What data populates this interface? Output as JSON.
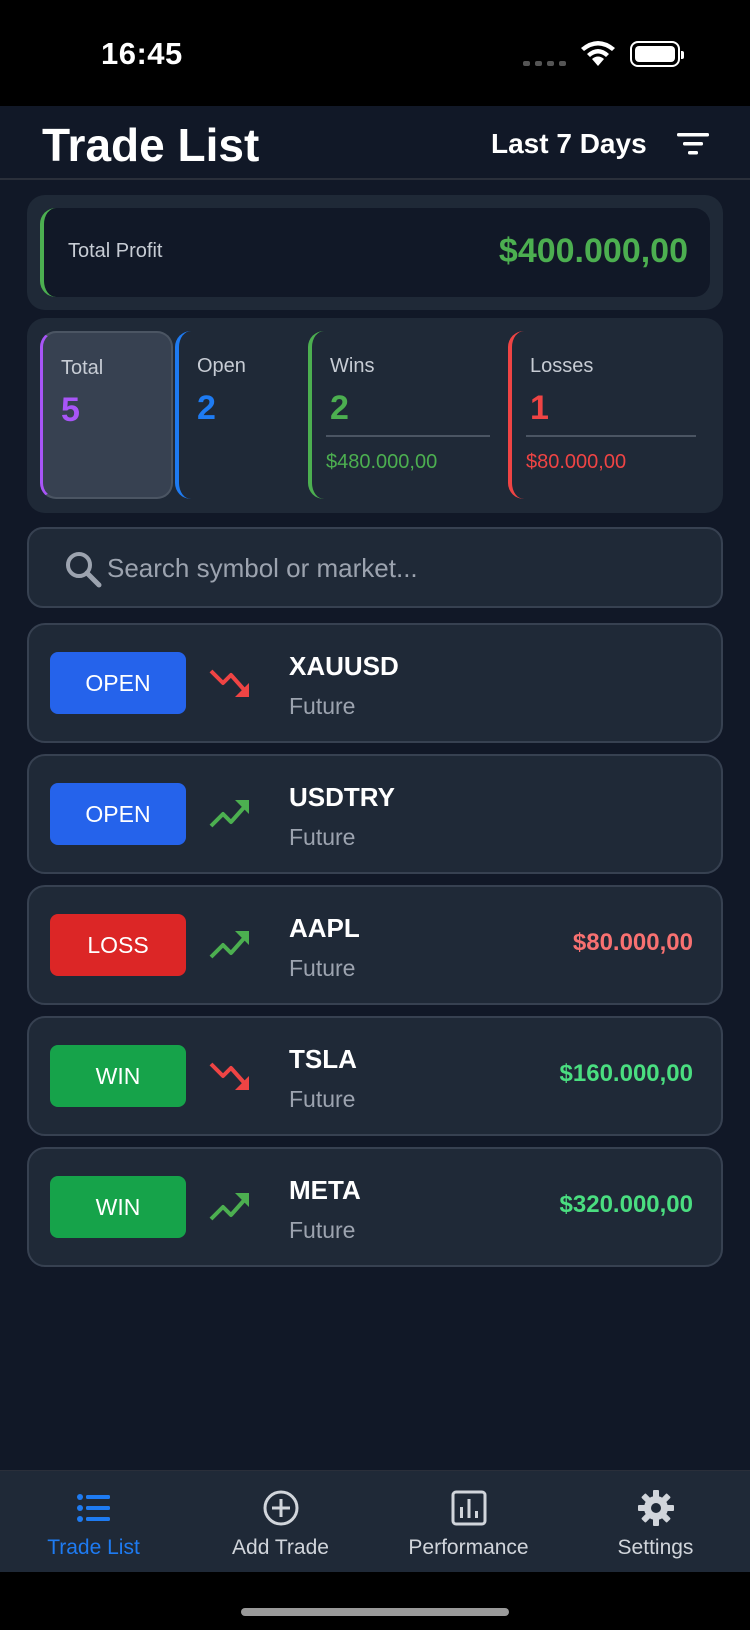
{
  "status_bar": {
    "time": "16:45"
  },
  "header": {
    "title": "Trade List",
    "range_label": "Last 7 Days"
  },
  "profit": {
    "label": "Total Profit",
    "value": "$400.000,00",
    "color": "#4caf50"
  },
  "stats": {
    "total": {
      "label": "Total",
      "value": "5",
      "color": "#a855f7"
    },
    "open": {
      "label": "Open",
      "value": "2",
      "color": "#1e7bf2"
    },
    "wins": {
      "label": "Wins",
      "value": "2",
      "amount": "$480.000,00",
      "color": "#4caf50"
    },
    "losses": {
      "label": "Losses",
      "value": "1",
      "amount": "$80.000,00",
      "color": "#ef4444"
    }
  },
  "search": {
    "placeholder": "Search symbol or market..."
  },
  "trades": [
    {
      "status": "OPEN",
      "status_color": "#2563eb",
      "trend": "down",
      "symbol": "XAUUSD",
      "market": "Future",
      "amount": ""
    },
    {
      "status": "OPEN",
      "status_color": "#2563eb",
      "trend": "up",
      "symbol": "USDTRY",
      "market": "Future",
      "amount": ""
    },
    {
      "status": "LOSS",
      "status_color": "#dc2626",
      "trend": "up",
      "symbol": "AAPL",
      "market": "Future",
      "amount": "$80.000,00",
      "amount_color": "#f87171"
    },
    {
      "status": "WIN",
      "status_color": "#16a34a",
      "trend": "down",
      "symbol": "TSLA",
      "market": "Future",
      "amount": "$160.000,00",
      "amount_color": "#4ade80"
    },
    {
      "status": "WIN",
      "status_color": "#16a34a",
      "trend": "up",
      "symbol": "META",
      "market": "Future",
      "amount": "$320.000,00",
      "amount_color": "#4ade80"
    }
  ],
  "tabs": [
    {
      "label": "Trade List",
      "icon": "list-icon",
      "active": true
    },
    {
      "label": "Add Trade",
      "icon": "plus-circle-icon",
      "active": false
    },
    {
      "label": "Performance",
      "icon": "bar-chart-icon",
      "active": false
    },
    {
      "label": "Settings",
      "icon": "gear-icon",
      "active": false
    }
  ],
  "colors": {
    "background": "#111827",
    "card": "#1f2937",
    "accent": "#1e7bf2"
  }
}
